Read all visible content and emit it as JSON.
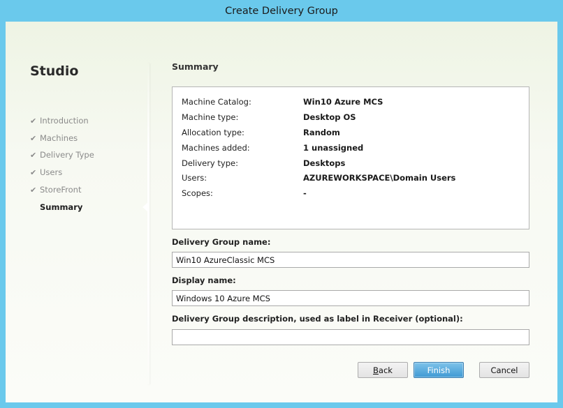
{
  "window": {
    "title": "Create Delivery Group"
  },
  "sidebar": {
    "app_name": "Studio",
    "steps": [
      {
        "label": "Introduction",
        "state": "done"
      },
      {
        "label": "Machines",
        "state": "done"
      },
      {
        "label": "Delivery Type",
        "state": "done"
      },
      {
        "label": "Users",
        "state": "done"
      },
      {
        "label": "StoreFront",
        "state": "done"
      },
      {
        "label": "Summary",
        "state": "active"
      }
    ],
    "check_glyph": "✔"
  },
  "main": {
    "title": "Summary",
    "summary": [
      {
        "key": "Machine Catalog:",
        "value": "Win10 Azure MCS"
      },
      {
        "key": "Machine type:",
        "value": "Desktop OS"
      },
      {
        "key": "Allocation type:",
        "value": "Random"
      },
      {
        "key": "Machines added:",
        "value": "1 unassigned"
      },
      {
        "key": "Delivery type:",
        "value": "Desktops"
      },
      {
        "key": "Users:",
        "value": "AZUREWORKSPACE\\Domain Users"
      },
      {
        "key": "Scopes:",
        "value": "-"
      }
    ],
    "group_name_label": "Delivery Group name:",
    "group_name_value": "Win10 AzureClassic MCS",
    "display_name_label": "Display name:",
    "display_name_value": "Windows 10 Azure MCS",
    "description_label": "Delivery Group description, used as label in Receiver (optional):",
    "description_value": ""
  },
  "buttons": {
    "back_first": "B",
    "back_rest": "ack",
    "finish": "Finish",
    "cancel": "Cancel"
  }
}
